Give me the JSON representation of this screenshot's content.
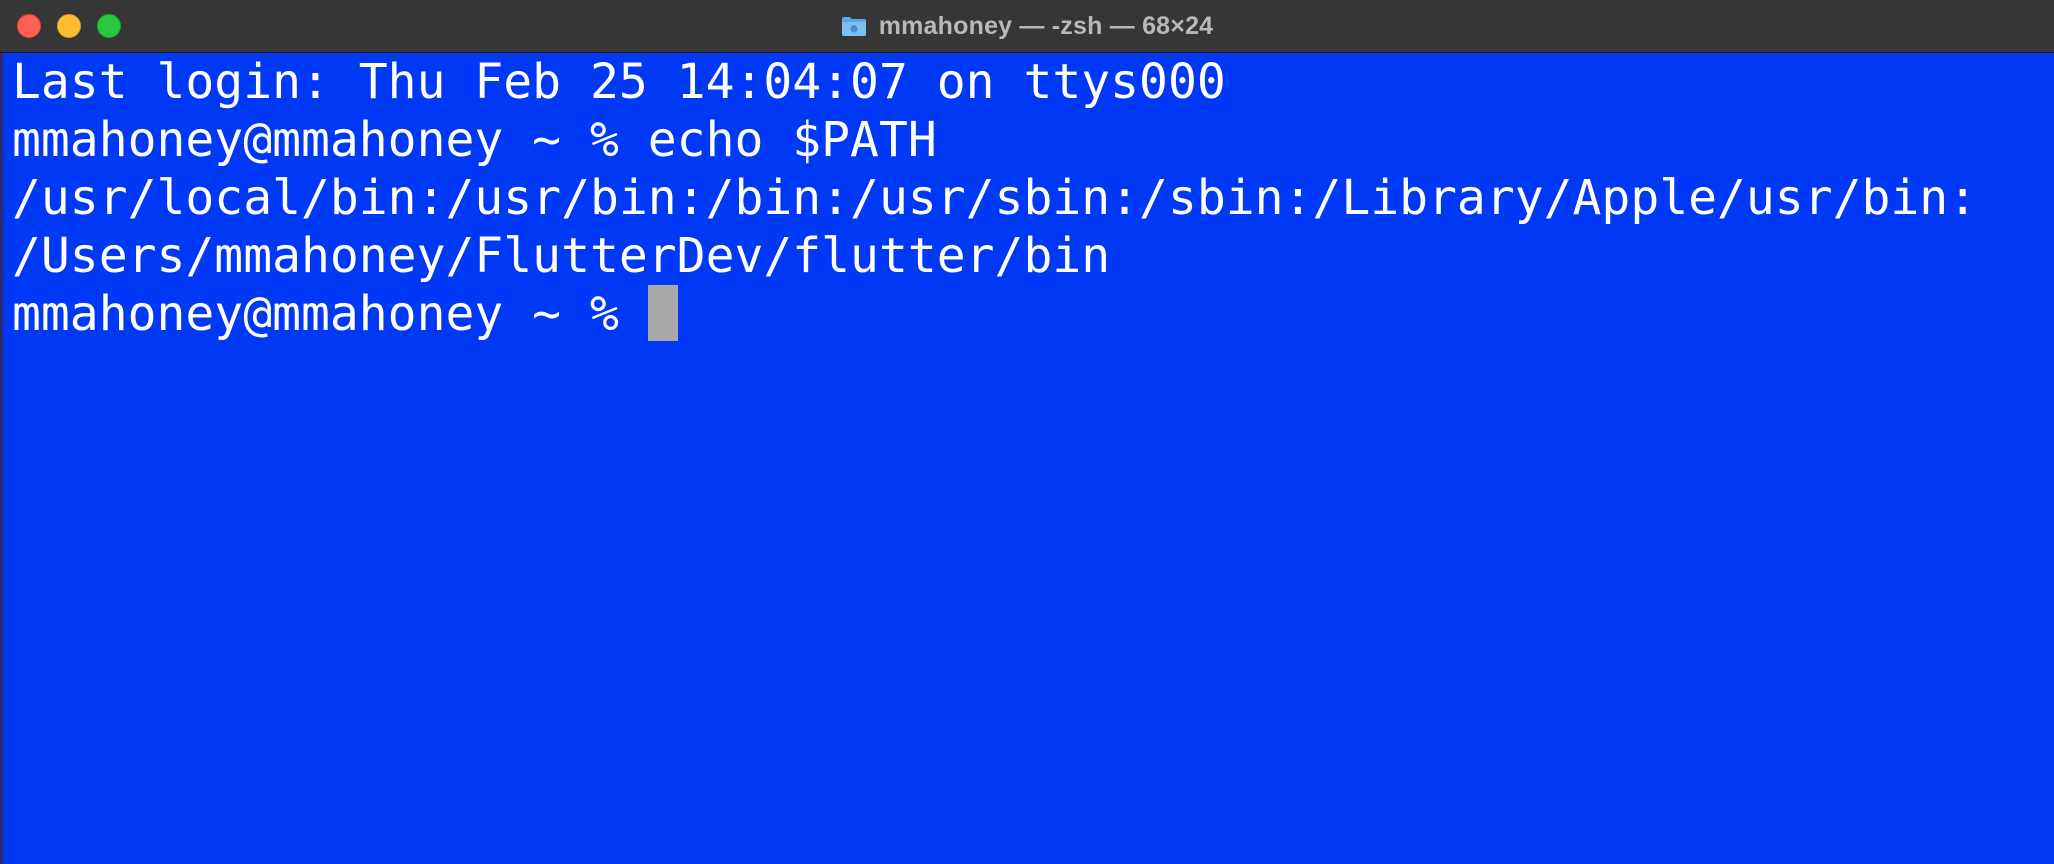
{
  "window": {
    "title": "mmahoney — -zsh — 68×24",
    "folder_icon": "folder-icon",
    "background_color": "#0039f5",
    "text_color": "#ffffff"
  },
  "terminal": {
    "lines": [
      "Last login: Thu Feb 25 14:04:07 on ttys000",
      "mmahoney@mmahoney ~ % echo $PATH",
      "/usr/local/bin:/usr/bin:/bin:/usr/sbin:/sbin:/Library/Apple/usr/bin:",
      "/Users/mmahoney/FlutterDev/flutter/bin"
    ],
    "prompt": "mmahoney@mmahoney ~ % "
  }
}
